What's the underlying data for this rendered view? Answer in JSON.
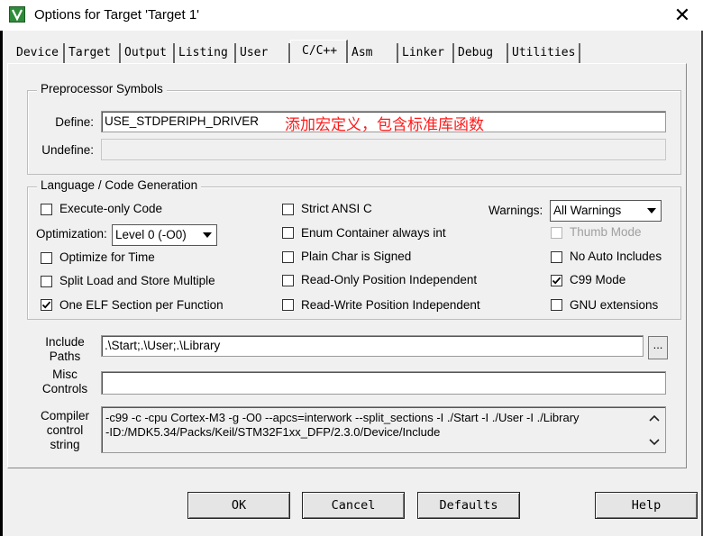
{
  "window": {
    "title": "Options for Target 'Target 1'",
    "close_glyph": "✕"
  },
  "tabs": [
    {
      "label": "Device"
    },
    {
      "label": "Target"
    },
    {
      "label": "Output"
    },
    {
      "label": "Listing"
    },
    {
      "label": "User"
    },
    {
      "label": "C/C++",
      "active": true
    },
    {
      "label": "Asm"
    },
    {
      "label": "Linker"
    },
    {
      "label": "Debug"
    },
    {
      "label": "Utilities"
    }
  ],
  "preprocessor": {
    "legend": "Preprocessor Symbols",
    "define_label": "Define:",
    "define_value": "USE_STDPERIPH_DRIVER",
    "undefine_label": "Undefine:",
    "undefine_value": ""
  },
  "annotation": "添加宏定义，包含标准库函数",
  "codegen": {
    "legend": "Language / Code Generation",
    "execute_only": {
      "label": "Execute-only Code",
      "checked": false
    },
    "optimization_label": "Optimization:",
    "optimization_value": "Level 0 (-O0)",
    "optimize_time": {
      "label": "Optimize for Time",
      "checked": false
    },
    "split_load": {
      "label": "Split Load and Store Multiple",
      "checked": false
    },
    "one_elf": {
      "label": "One ELF Section per Function",
      "checked": true
    },
    "strict_ansi": {
      "label": "Strict ANSI C",
      "checked": false
    },
    "enum_container": {
      "label": "Enum Container always int",
      "checked": false
    },
    "plain_char": {
      "label": "Plain Char is Signed",
      "checked": false
    },
    "ro_position": {
      "label": "Read-Only Position Independent",
      "checked": false
    },
    "rw_position": {
      "label": "Read-Write Position Independent",
      "checked": false
    },
    "warnings_label": "Warnings:",
    "warnings_value": "All Warnings",
    "thumb_mode": {
      "label": "Thumb Mode",
      "checked": false,
      "disabled": true
    },
    "no_auto_includes": {
      "label": "No Auto Includes",
      "checked": false
    },
    "c99_mode": {
      "label": "C99 Mode",
      "checked": true
    },
    "gnu_extensions": {
      "label": "GNU extensions",
      "checked": false
    }
  },
  "include_paths": {
    "label_line1": "Include",
    "label_line2": "Paths",
    "value": ".\\Start;.\\User;.\\Library",
    "browse_label": "..."
  },
  "misc_controls": {
    "label_line1": "Misc",
    "label_line2": "Controls",
    "value": ""
  },
  "compiler_control": {
    "label_line1": "Compiler",
    "label_line2": "control",
    "label_line3": "string",
    "line1": "-c99 -c -cpu Cortex-M3 -g -O0 --apcs=interwork --split_sections -I ./Start -I ./User -I ./Library",
    "line2": "-ID:/MDK5.34/Packs/Keil/STM32F1xx_DFP/2.3.0/Device/Include"
  },
  "buttons": {
    "ok": "OK",
    "cancel": "Cancel",
    "defaults": "Defaults",
    "help": "Help"
  },
  "colors": {
    "annotation": "#ff1a1a",
    "dialog_bg": "#f0f0f0"
  }
}
